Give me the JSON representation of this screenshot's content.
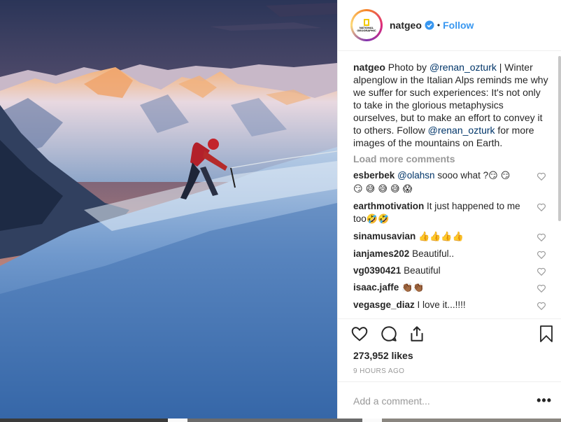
{
  "post": {
    "author": "natgeo",
    "follow_label": "Follow",
    "dot": "•",
    "avatar_text": "NATIONAL GEOGRAPHIC",
    "caption": {
      "author": "natgeo",
      "part1": " Photo by ",
      "mention1": "@renan_ozturk",
      "part2": " | Winter alpenglow in the Italian Alps reminds me why we suffer for such experiences: It's not only to take in the glorious metaphysics ourselves, but to make an effort to convey it to others. Follow ",
      "mention2": "@renan_ozturk",
      "part3": " for more images of the mountains on Earth."
    },
    "load_more": "Load more comments",
    "comments": [
      {
        "user": "esberbek",
        "mention": "@olahsn",
        "text": " sooo what ?",
        "emoji": "😏 😏 😏 😅 😅 😅 😱"
      },
      {
        "user": "earthmotivation",
        "mention": "",
        "text": " It just happened to me too",
        "emoji": "🤣🤣"
      },
      {
        "user": "sinamusavian",
        "mention": "",
        "text": " ",
        "emoji": "👍👍👍👍"
      },
      {
        "user": "ianjames202",
        "mention": "",
        "text": " Beautiful..",
        "emoji": ""
      },
      {
        "user": "vg0390421",
        "mention": "",
        "text": " Beautiful",
        "emoji": ""
      },
      {
        "user": "isaac.jaffe",
        "mention": "",
        "text": " ",
        "emoji": "👏🏾👏🏾"
      },
      {
        "user": "vegasge_diaz",
        "mention": "",
        "text": " I love it...!!!!",
        "emoji": ""
      }
    ],
    "likes": "273,952 likes",
    "time": "9 HOURS AGO",
    "add_comment_placeholder": "Add a comment...",
    "more_options": "•••"
  },
  "icons": {
    "verified": "verified-badge-icon",
    "like": "heart-icon",
    "comment": "comment-icon",
    "share": "share-icon",
    "save": "bookmark-icon"
  },
  "colors": {
    "link": "#3897f0",
    "mention": "#003569",
    "muted": "#999999",
    "border": "#efefef"
  }
}
